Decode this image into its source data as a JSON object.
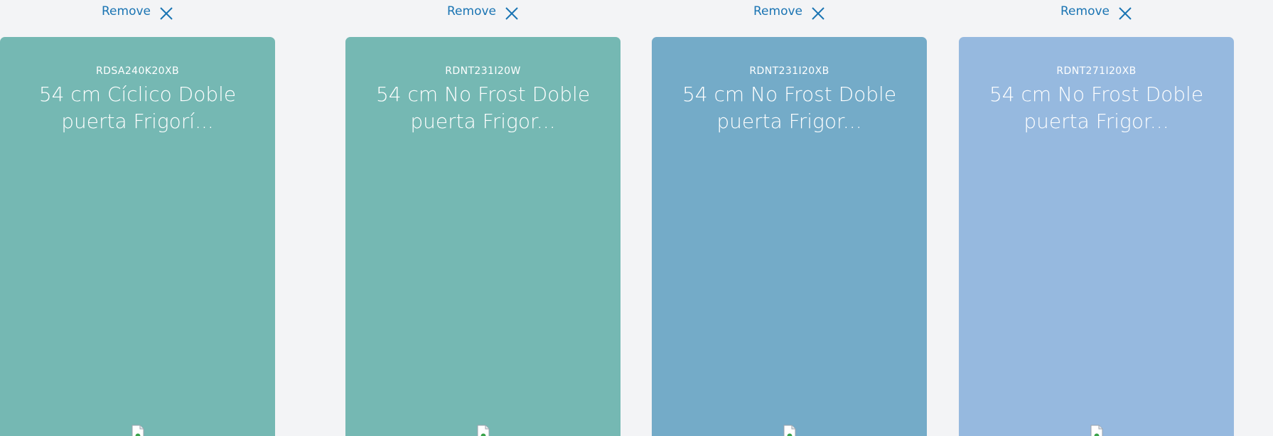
{
  "compare": {
    "products": [
      {
        "remove_label": "Remove",
        "sku": "RDSA240K20XB",
        "title": "54 cm Cíclico Doble puerta Frigorí...",
        "card_color": "#75b8b3"
      },
      {
        "remove_label": "Remove",
        "sku": "RDNT231I20W",
        "title": "54 cm No Frost Doble puerta Frigor...",
        "card_color": "#75b8b3"
      },
      {
        "remove_label": "Remove",
        "sku": "RDNT231I20XB",
        "title": "54 cm No Frost Doble puerta Frigor...",
        "card_color": "#74abc8"
      },
      {
        "remove_label": "Remove",
        "sku": "RDNT271I20XB",
        "title": "54 cm No Frost Doble puerta Frigor...",
        "card_color": "#96b9df"
      }
    ],
    "icons": {
      "remove": "close-x-icon",
      "product_image": "broken-image-icon"
    },
    "colors": {
      "page_background": "#f3f4f6",
      "link": "#1a74b3",
      "card_text": "#ffffff"
    }
  }
}
